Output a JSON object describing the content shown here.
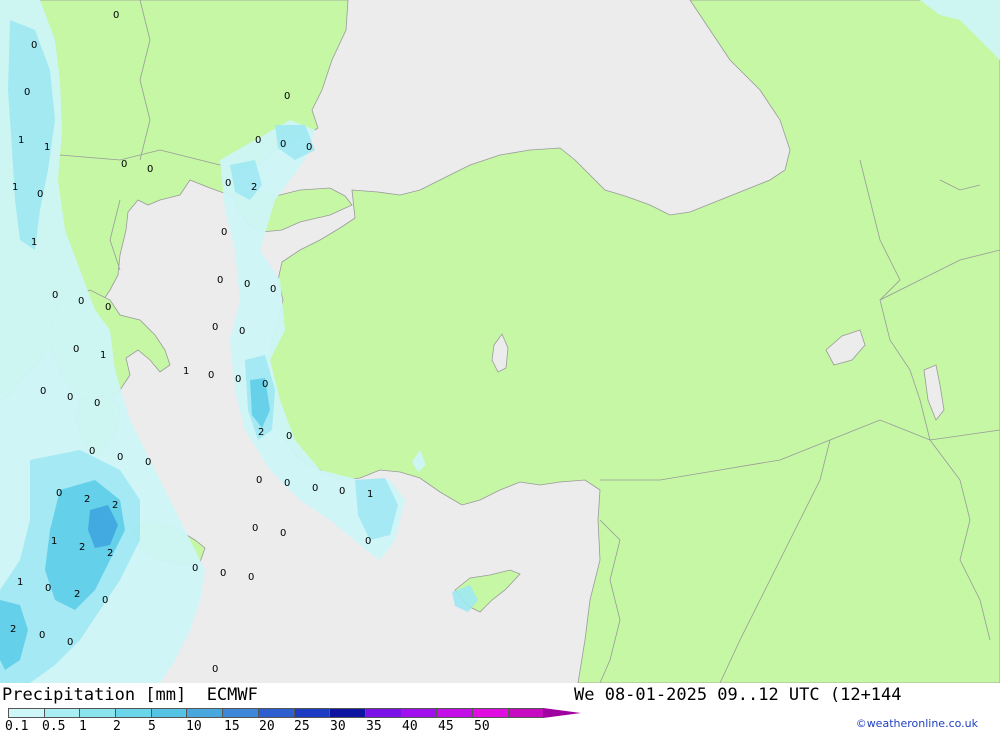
{
  "map": {
    "colors": {
      "sea": "#ececec",
      "land": "#c5f7a4",
      "border": "#9a9a9a",
      "precip_light": "#cdf6f8",
      "precip_mid": "#9fe8f2",
      "precip_heavy": "#5ecde8",
      "precip_peak": "#3ba0de"
    },
    "labels": [
      {
        "id": "l1",
        "text": "0"
      },
      {
        "id": "l2",
        "text": "0"
      },
      {
        "id": "l3",
        "text": "0"
      },
      {
        "id": "l4",
        "text": "0"
      },
      {
        "id": "l5",
        "text": "1"
      },
      {
        "id": "l6",
        "text": "1"
      },
      {
        "id": "l7",
        "text": "0"
      },
      {
        "id": "l8",
        "text": "1"
      },
      {
        "id": "l9",
        "text": "0"
      },
      {
        "id": "l10",
        "text": "0"
      },
      {
        "id": "l11",
        "text": "0"
      },
      {
        "id": "l12",
        "text": "0"
      },
      {
        "id": "l13",
        "text": "0"
      },
      {
        "id": "l14",
        "text": "1"
      },
      {
        "id": "l15",
        "text": "0"
      },
      {
        "id": "l16",
        "text": "0"
      },
      {
        "id": "l17",
        "text": "0"
      },
      {
        "id": "l18",
        "text": "0"
      },
      {
        "id": "l19",
        "text": "0"
      },
      {
        "id": "l20",
        "text": "0"
      },
      {
        "id": "l21",
        "text": "2"
      },
      {
        "id": "l22",
        "text": "0"
      },
      {
        "id": "l23",
        "text": "0"
      },
      {
        "id": "l24",
        "text": "0"
      },
      {
        "id": "l25",
        "text": "0"
      },
      {
        "id": "l26",
        "text": "0"
      },
      {
        "id": "l27",
        "text": "0"
      },
      {
        "id": "l28",
        "text": "0"
      },
      {
        "id": "l29",
        "text": "1"
      },
      {
        "id": "l30",
        "text": "0"
      },
      {
        "id": "l31",
        "text": "0"
      },
      {
        "id": "l32",
        "text": "0"
      },
      {
        "id": "l33",
        "text": "2"
      },
      {
        "id": "l34",
        "text": "0"
      },
      {
        "id": "l35",
        "text": "0"
      },
      {
        "id": "l36",
        "text": "0"
      },
      {
        "id": "l37",
        "text": "0"
      },
      {
        "id": "l38",
        "text": "0"
      },
      {
        "id": "l39",
        "text": "0"
      },
      {
        "id": "l40",
        "text": "1"
      },
      {
        "id": "l41",
        "text": "0"
      },
      {
        "id": "l42",
        "text": "2"
      },
      {
        "id": "l43",
        "text": "2"
      },
      {
        "id": "l44",
        "text": "1"
      },
      {
        "id": "l45",
        "text": "2"
      },
      {
        "id": "l46",
        "text": "2"
      },
      {
        "id": "l47",
        "text": "1"
      },
      {
        "id": "l48",
        "text": "0"
      },
      {
        "id": "l49",
        "text": "2"
      },
      {
        "id": "l50",
        "text": "0"
      },
      {
        "id": "l51",
        "text": "2"
      },
      {
        "id": "l52",
        "text": "0"
      },
      {
        "id": "l53",
        "text": "0"
      },
      {
        "id": "l54",
        "text": "0"
      },
      {
        "id": "l55",
        "text": "0"
      },
      {
        "id": "l56",
        "text": "0"
      },
      {
        "id": "l57",
        "text": "0"
      },
      {
        "id": "l58",
        "text": "0"
      },
      {
        "id": "l59",
        "text": "0"
      },
      {
        "id": "l60",
        "text": "1"
      },
      {
        "id": "l61",
        "text": "0"
      },
      {
        "id": "l62",
        "text": "0"
      },
      {
        "id": "l63",
        "text": "0"
      }
    ]
  },
  "footer": {
    "title": "Precipitation [mm]  ECMWF",
    "datetime": "We 08-01-2025 09..12 UTC (12+144",
    "credit": "©weatheronline.co.uk",
    "legend": {
      "colors": [
        "#cdf6f8",
        "#a9eef3",
        "#8ae4ee",
        "#6ad6ea",
        "#55c3e4",
        "#48a8de",
        "#3d86d8",
        "#2d5fd0",
        "#1d3cc4",
        "#0c14a0",
        "#7b12e8",
        "#a010ee",
        "#c30ee8",
        "#e00ce0",
        "#c80ac0"
      ],
      "arrow_color": "#a000a0",
      "ticks": [
        "0.1",
        "0.5",
        "1",
        "2",
        "5",
        "10",
        "15",
        "20",
        "25",
        "30",
        "35",
        "40",
        "45",
        "50"
      ]
    }
  }
}
